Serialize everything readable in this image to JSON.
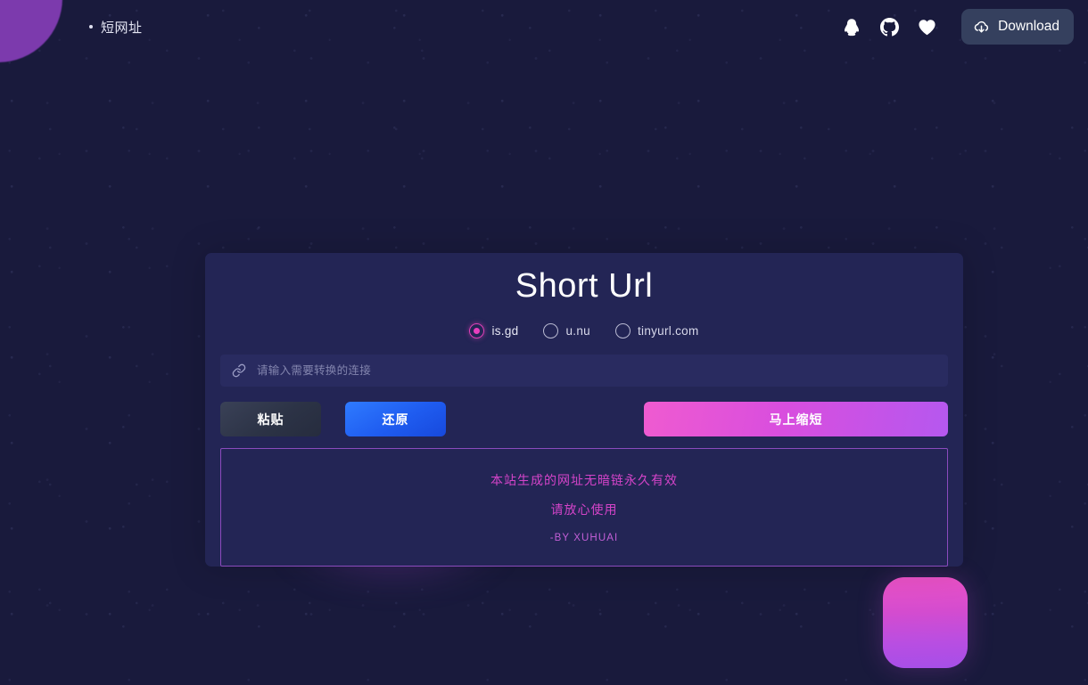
{
  "topbar": {
    "brand": "短网址",
    "icons": [
      {
        "name": "qq-icon",
        "label": "QQ"
      },
      {
        "name": "github-icon",
        "label": "GitHub"
      },
      {
        "name": "heart-icon",
        "label": "Favorite"
      }
    ],
    "download_label": "Download",
    "download_icon": "cloud-download-icon"
  },
  "card": {
    "title": "Short Url",
    "providers": [
      {
        "value": "is.gd",
        "label": "is.gd",
        "selected": true
      },
      {
        "value": "u.nu",
        "label": "u.nu",
        "selected": false
      },
      {
        "value": "tinyurl.com",
        "label": "tinyurl.com",
        "selected": false
      }
    ],
    "input": {
      "icon": "link-icon",
      "placeholder": "请输入需要转换的连接",
      "value": ""
    },
    "buttons": {
      "paste": "粘贴",
      "restore": "还原",
      "shorten": "马上缩短"
    },
    "notice": {
      "line1": "本站生成的网址无暗链永久有效",
      "line2": "请放心使用",
      "author": "-BY XUHUAI"
    }
  },
  "colors": {
    "background": "#191a3c",
    "card": "#232555",
    "accent_pink": "#e83fbf",
    "accent_purple": "#8b4bbd",
    "restore_blue": "#1f5cf0",
    "notice_text": "#d444c9",
    "blob_purple": "#7c3aad"
  }
}
